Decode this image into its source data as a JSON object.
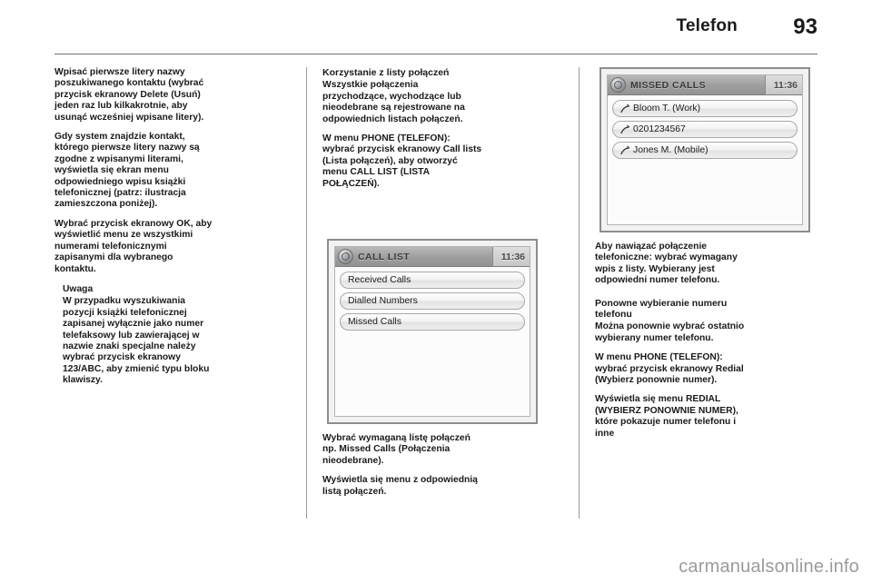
{
  "header": {
    "title": "Telefon",
    "page_number": "93"
  },
  "columns": {
    "col1": [
      {
        "type": "paragraph",
        "text": "Wpisać pierwsze litery nazwy poszukiwanego kontaktu (wybrać przycisk ekranowy Delete (Usuń) jeden raz lub kilkakrotnie, aby usunąć wcześniej wpisane litery)."
      },
      {
        "type": "paragraph",
        "text": "Gdy system znajdzie kontakt, którego pierwsze litery nazwy są zgodne z wpisanymi literami, wyświetla się ekran menu odpowiedniego wpisu książki telefonicznej (patrz: ilustracja zamieszczona poniżej)."
      },
      {
        "type": "paragraph",
        "text": "Wybrać przycisk ekranowy OK, aby wyświetlić menu ze wszystkimi numerami telefonicznymi zapisanymi dla wybranego kontaktu."
      }
    ],
    "note": {
      "title": "Uwaga",
      "body": "W przypadku wyszukiwania pozycji książki telefonicznej zapisanej wyłącznie jako numer telefaksowy lub zawierającej w nazwie znaki specjalne należy wybrać przycisk ekranowy 123/ABC, aby zmienić typu bloku klawiszy."
    },
    "col2": {
      "heading": "Korzystanie z listy połączeń",
      "paragraphs": [
        "Wszystkie połączenia przychodzące, wychodzące lub nieodebrane są rejestrowane na odpowiednich listach połączeń.",
        "W menu PHONE (TELEFON): wybrać przycisk ekranowy Call lists (Lista połączeń), aby otworzyć menu CALL LIST (LISTA POŁĄCZEŃ)."
      ],
      "after_image": [
        "Wybrać wymaganą listę połączeń np. Missed Calls (Połączenia nieodebrane).",
        "Wyświetla się menu z odpowiednią listą połączeń."
      ]
    },
    "col3": {
      "paragraphs": [
        "Aby nawiązać połączenie telefoniczne: wybrać wymagany wpis z listy. Wybierany jest odpowiedni numer telefonu."
      ],
      "heading": "Ponowne wybieranie numeru telefonu",
      "paragraphs2": [
        "Można ponownie wybrać ostatnio wybierany numer telefonu.",
        "W menu PHONE (TELEFON): wybrać przycisk ekranowy Redial (Wybierz ponownie numer).",
        "Wyświetla się menu REDIAL (WYBIERZ PONOWNIE NUMER), które pokazuje numer telefonu i inne"
      ]
    }
  },
  "screens": {
    "call_list": {
      "icon": "phone-globe-icon",
      "title": "CALL LIST",
      "clock": "11:36",
      "items": [
        {
          "label": "Received Calls"
        },
        {
          "label": "Dialled Numbers"
        },
        {
          "label": "Missed Calls"
        }
      ]
    },
    "missed_calls": {
      "icon": "phone-globe-icon",
      "title": "MISSED CALLS",
      "clock": "11:36",
      "items": [
        {
          "icon": "missed-call-icon",
          "label": "Bloom T. (Work)"
        },
        {
          "icon": "missed-call-icon",
          "label": "0201234567"
        },
        {
          "icon": "missed-call-icon",
          "label": "Jones M. (Mobile)"
        }
      ]
    }
  },
  "watermark": "carmanualsonline.info"
}
